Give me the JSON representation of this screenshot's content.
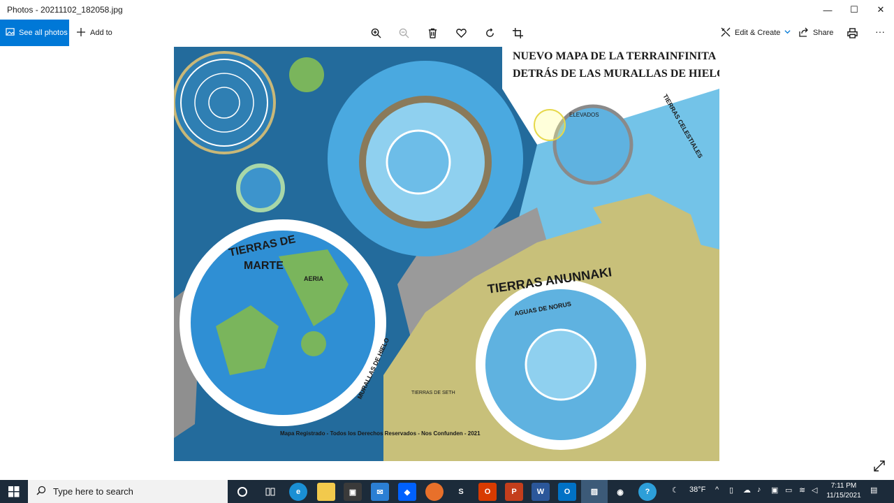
{
  "window": {
    "title": "Photos - 20211102_182058.jpg",
    "minimize_label": "—",
    "maximize_label": "☐",
    "close_label": "✕"
  },
  "toolbar": {
    "see_all_label": "See all photos",
    "add_to_label": "Add to",
    "edit_create_label": "Edit & Create",
    "share_label": "Share",
    "more_label": "···",
    "accent": "#0078d7"
  },
  "map": {
    "title_line1": "NUEVO MAPA DE LA TERRAINFINITA",
    "title_line2": "DETRÁS DE LAS MURALLAS DE HIELO",
    "label_tierras_marte_1": "TIERRAS DE",
    "label_tierras_marte_2": "MARTE",
    "label_anunnaki": "TIERRAS ANUNNAKI",
    "label_aguas_norus": "AGUAS DE NORUS",
    "label_murallas": "MURALLAS DE HIELO",
    "label_celestiales": "TIERRAS CELESTIALES",
    "label_elevados": "ELEVADOS",
    "label_aeria": "AERIA",
    "label_tierras_seth": "TIERRAS DE SETH",
    "footer": "Mapa Registrado - Todos los Derechos Reservados - Nos Confunden - 2021"
  },
  "taskbar": {
    "search_placeholder": "Type here to search",
    "temperature": "38°F",
    "time": "7:11 PM",
    "date": "11/15/2021"
  }
}
